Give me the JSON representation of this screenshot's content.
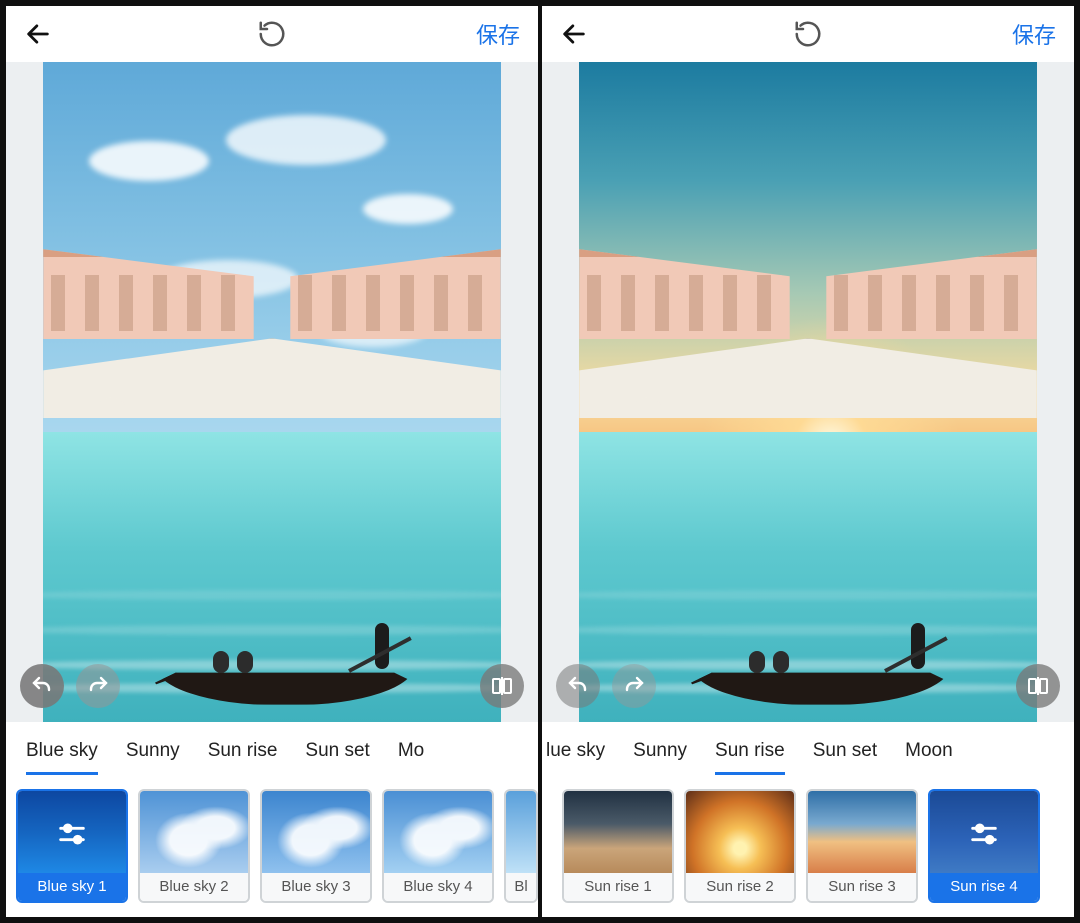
{
  "left": {
    "header": {
      "save_label": "保存"
    },
    "categories": [
      {
        "label": "Blue sky",
        "active": true
      },
      {
        "label": "Sunny",
        "active": false
      },
      {
        "label": "Sun rise",
        "active": false
      },
      {
        "label": "Sun set",
        "active": false
      },
      {
        "label": "Mo",
        "active": false
      }
    ],
    "thumbs": [
      {
        "label": "Blue sky 1",
        "selected": true
      },
      {
        "label": "Blue sky 2",
        "selected": false
      },
      {
        "label": "Blue sky 3",
        "selected": false
      },
      {
        "label": "Blue sky 4",
        "selected": false
      },
      {
        "label": "Bl",
        "selected": false
      }
    ]
  },
  "right": {
    "header": {
      "save_label": "保存"
    },
    "categories": [
      {
        "label": "lue sky",
        "active": false
      },
      {
        "label": "Sunny",
        "active": false
      },
      {
        "label": "Sun rise",
        "active": true
      },
      {
        "label": "Sun set",
        "active": false
      },
      {
        "label": "Moon",
        "active": false
      }
    ],
    "thumbs": [
      {
        "label": "Sun rise 1",
        "selected": false
      },
      {
        "label": "Sun rise 2",
        "selected": false
      },
      {
        "label": "Sun rise 3",
        "selected": false
      },
      {
        "label": "Sun rise 4",
        "selected": true
      }
    ]
  },
  "icons": {
    "back": "back-arrow",
    "reset": "undo-history",
    "undo": "undo",
    "redo": "redo",
    "compare": "compare-split",
    "sliders": "sliders"
  }
}
